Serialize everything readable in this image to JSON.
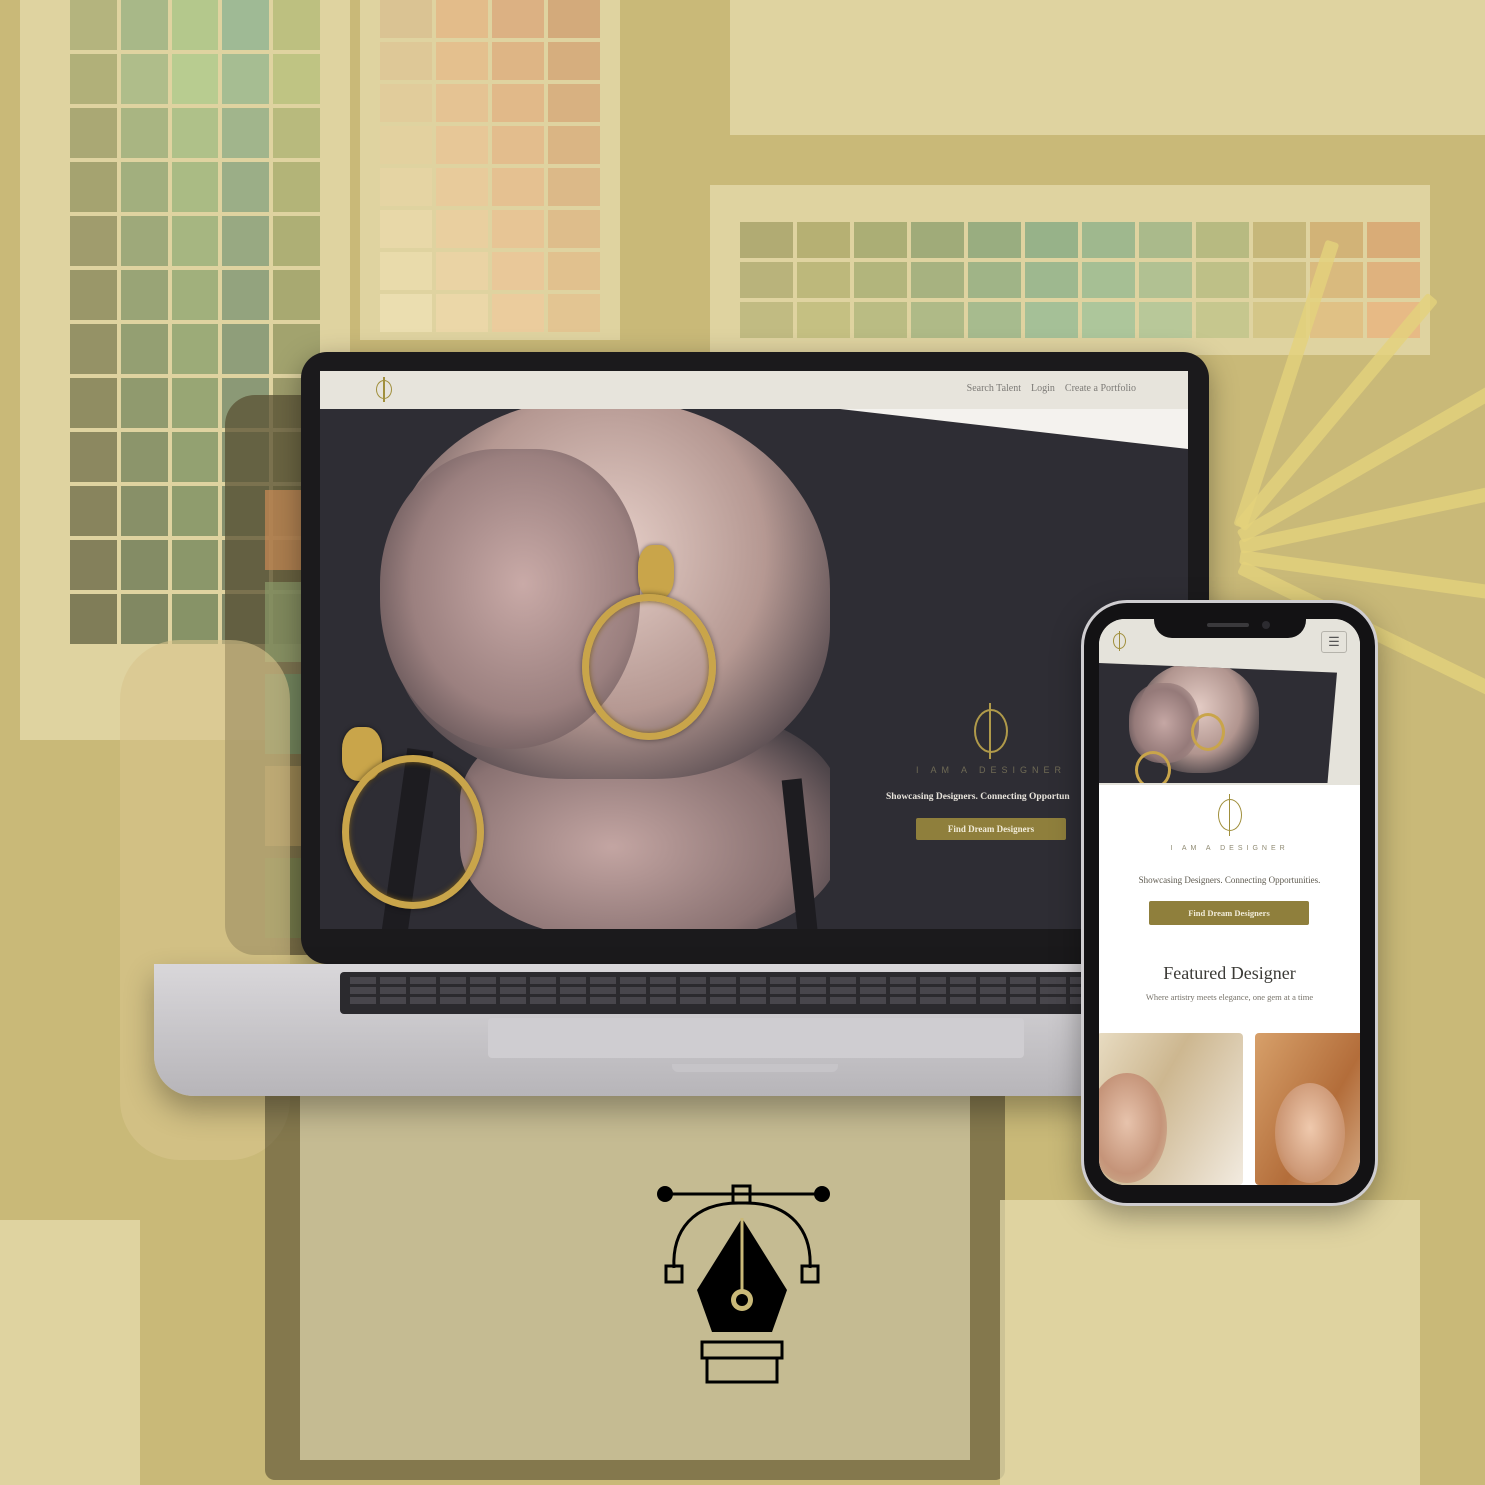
{
  "colors": {
    "background": "#c9b978",
    "accent_gold": "#8f7f3c",
    "logo_gold": "#a08f3c",
    "hero_dark": "#2e2d34",
    "nav_bg": "#e7e4dc"
  },
  "laptop": {
    "nav": {
      "logo_icon": "brand-logo-icon",
      "links": [
        "Search Talent",
        "Login",
        "Create a Portfolio"
      ]
    },
    "hero": {
      "brand_text": "I AM A DESIGNER",
      "tagline": "Showcasing Designers. Connecting Opportun",
      "cta": "Find Dream Designers"
    }
  },
  "phone": {
    "nav": {
      "logo_icon": "brand-logo-icon",
      "menu_icon": "hamburger-menu-icon",
      "menu_glyph": "☰"
    },
    "brand_text": "I AM A DESIGNER",
    "tagline": "Showcasing Designers. Connecting Opportunities.",
    "cta": "Find Dream Designers",
    "featured": {
      "title": "Featured Designer",
      "subtitle": "Where artistry meets elegance, one gem at a time"
    }
  },
  "footer_icon": "pen-tool-icon"
}
